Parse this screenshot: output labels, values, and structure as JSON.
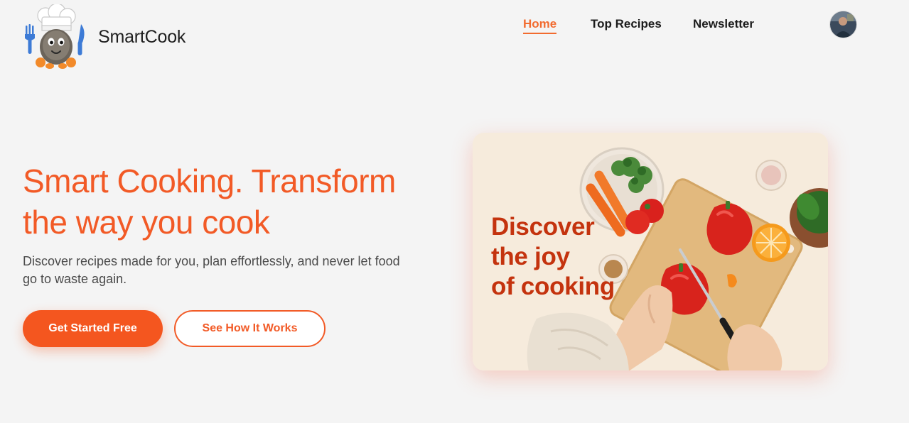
{
  "brand": {
    "name": "SmartCook"
  },
  "nav": {
    "items": [
      {
        "label": "Home",
        "active": true
      },
      {
        "label": "Top Recipes",
        "active": false
      },
      {
        "label": "Newsletter",
        "active": false
      }
    ]
  },
  "hero": {
    "title_line1": "Smart Cooking. Transform",
    "title_line2": "the way you cook",
    "subtitle_line1": "Discover recipes made for you, plan effortlessly, and never let food",
    "subtitle_line2": "go to waste again.",
    "primary_button": "Get Started Free",
    "secondary_button": "See How It Works",
    "card_caption_line1": "Discover",
    "card_caption_line2": "the joy",
    "card_caption_line3": "of cooking"
  },
  "colors": {
    "accent": "#f25a26",
    "primary_button": "#f4561f",
    "background": "#f4f4f4",
    "caption": "#c4330e"
  },
  "icons": {
    "logo": "chef-mascot-icon",
    "avatar": "user-avatar-icon"
  }
}
